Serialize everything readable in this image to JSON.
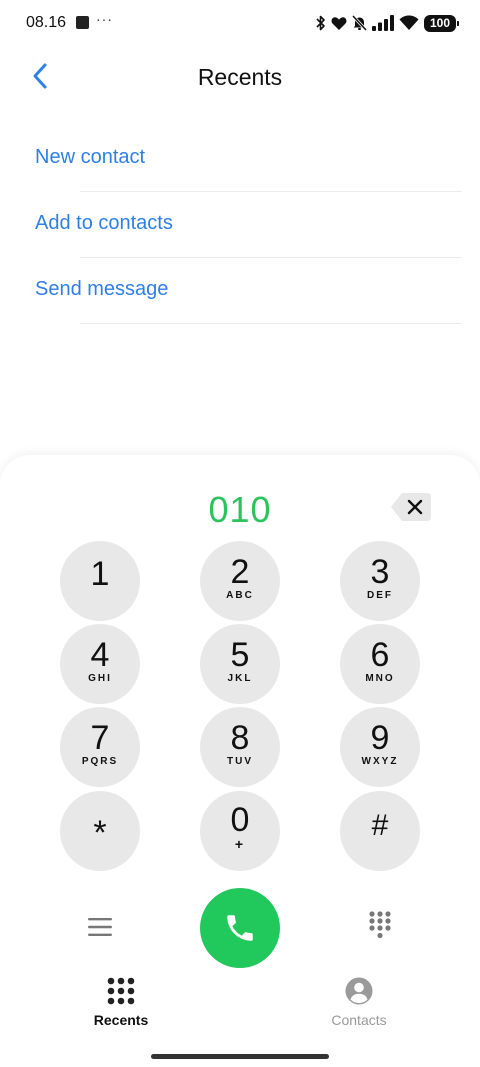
{
  "status_bar": {
    "time": "08.16",
    "dots": "···",
    "battery": "100"
  },
  "header": {
    "title": "Recents"
  },
  "actions": [
    {
      "label": "New contact"
    },
    {
      "label": "Add to contacts"
    },
    {
      "label": "Send message"
    }
  ],
  "dialer": {
    "number": "010",
    "keys": [
      {
        "digit": "1",
        "letters": ""
      },
      {
        "digit": "2",
        "letters": "ABC"
      },
      {
        "digit": "3",
        "letters": "DEF"
      },
      {
        "digit": "4",
        "letters": "GHI"
      },
      {
        "digit": "5",
        "letters": "JKL"
      },
      {
        "digit": "6",
        "letters": "MNO"
      },
      {
        "digit": "7",
        "letters": "PQRS"
      },
      {
        "digit": "8",
        "letters": "TUV"
      },
      {
        "digit": "9",
        "letters": "WXYZ"
      },
      {
        "digit": "*",
        "letters": ""
      },
      {
        "digit": "0",
        "letters": "+"
      },
      {
        "digit": "#",
        "letters": ""
      }
    ]
  },
  "bottom_nav": {
    "tabs": [
      {
        "label": "Recents",
        "icon": "dialpad-icon",
        "active": true
      },
      {
        "label": "Contacts",
        "icon": "person-circle-icon",
        "active": false
      }
    ]
  },
  "colors": {
    "accent_blue": "#2f7fe8",
    "dialed_green": "#2cc35d",
    "call_green": "#21c95c",
    "key_bg": "#e8e8e8"
  }
}
